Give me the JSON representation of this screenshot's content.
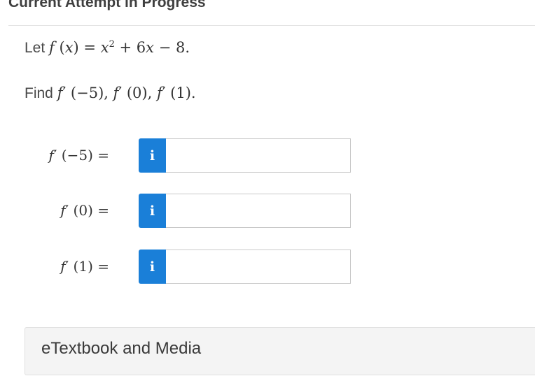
{
  "header": {
    "title": "Current Attempt in Progress"
  },
  "question": {
    "let_word": "Let",
    "func": "f",
    "var": "x",
    "var_x": "x",
    "exponent": "2",
    "plus_term": "+ 6",
    "minus_term": "− 8.",
    "equals": "=",
    "find_word": "Find",
    "find_f1": "f",
    "find_a1": "′ (−5), ",
    "find_f2": "f",
    "find_a2": "′ (0), ",
    "find_f3": "f",
    "find_a3": "′ (1)."
  },
  "answers": [
    {
      "func": "f",
      "label_rest": "′ (−5) =",
      "icon": "i",
      "value": ""
    },
    {
      "func": "f",
      "label_rest": "′ (0) =",
      "icon": "i",
      "value": ""
    },
    {
      "func": "f",
      "label_rest": "′ (1) =",
      "icon": "i",
      "value": ""
    }
  ],
  "etextbook": {
    "label": "eTextbook and Media"
  },
  "colors": {
    "info_button": "#1a7fd8",
    "panel_bg": "#f4f4f4"
  }
}
